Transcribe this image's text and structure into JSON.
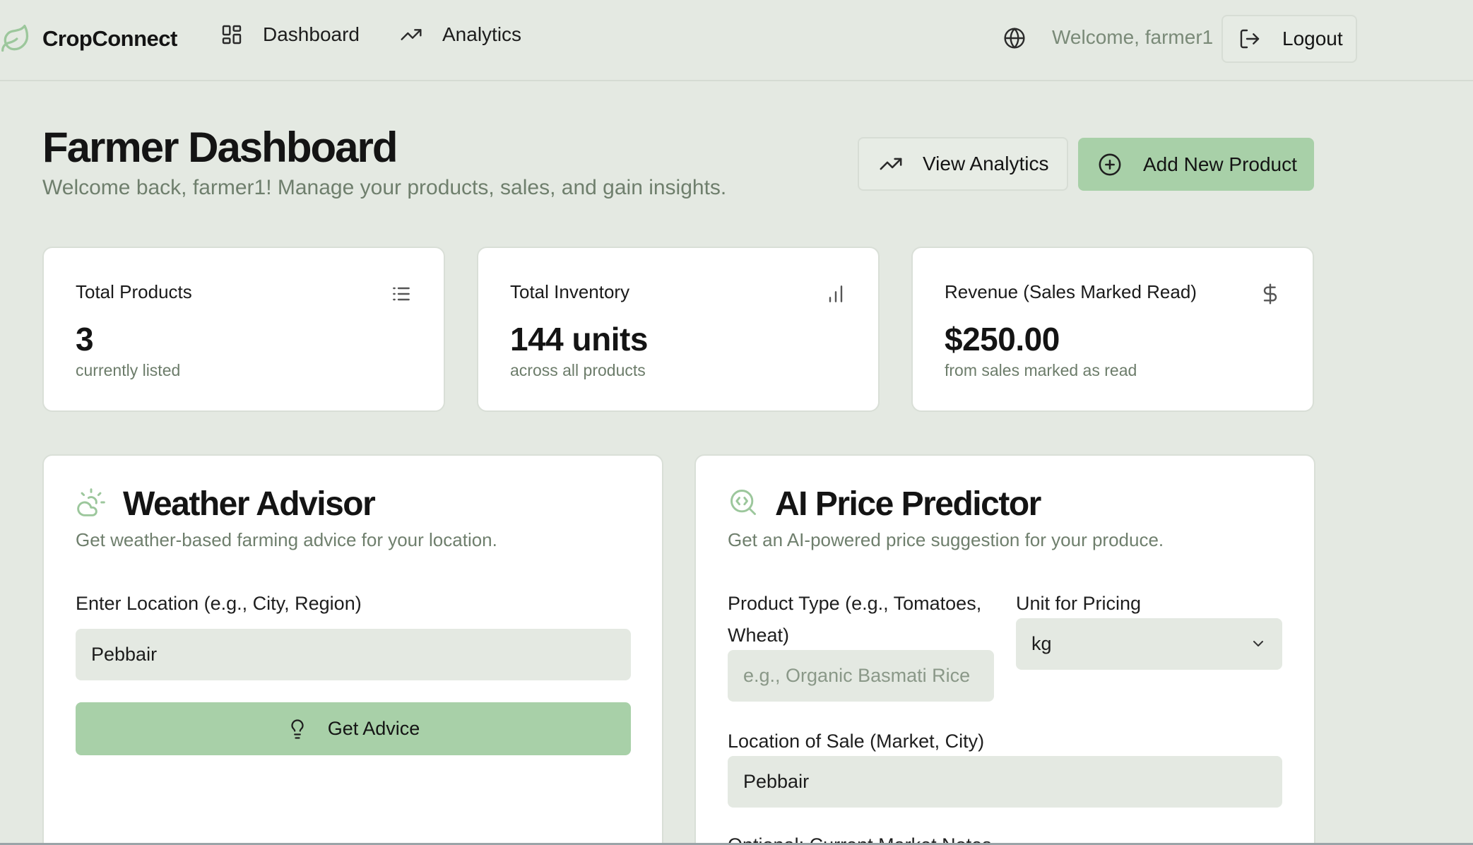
{
  "app": {
    "name": "CropConnect"
  },
  "nav": {
    "dashboard_label": "Dashboard",
    "analytics_label": "Analytics",
    "welcome_text": "Welcome, farmer1",
    "logout_label": "Logout"
  },
  "header": {
    "title": "Farmer Dashboard",
    "subtitle": "Welcome back, farmer1! Manage your products, sales, and gain insights.",
    "view_analytics_label": "View Analytics",
    "add_product_label": "Add New Product"
  },
  "stats": [
    {
      "label": "Total Products",
      "value": "3",
      "desc": "currently listed",
      "icon": "list-icon"
    },
    {
      "label": "Total Inventory",
      "value": "144 units",
      "desc": "across all products",
      "icon": "bar-chart-icon"
    },
    {
      "label": "Revenue (Sales Marked Read)",
      "value": "$250.00",
      "desc": "from sales marked as read",
      "icon": "dollar-icon"
    }
  ],
  "weather": {
    "title": "Weather Advisor",
    "subtitle": "Get weather-based farming advice for your location.",
    "location_label": "Enter Location (e.g., City, Region)",
    "location_value": "Pebbair",
    "button_label": "Get Advice"
  },
  "price": {
    "title": "AI Price Predictor",
    "subtitle": "Get an AI-powered price suggestion for your produce.",
    "product_label_line1": "Product Type (e.g., Tomatoes,",
    "product_label_line2": "Wheat)",
    "product_placeholder": "e.g., Organic Basmati Rice",
    "unit_label": "Unit for Pricing",
    "unit_value": "kg",
    "location_label": "Location of Sale (Market, City)",
    "location_value": "Pebbair",
    "notes_label": "Optional: Current Market Notes"
  },
  "colors": {
    "background": "#e4e9e2",
    "accent": "#a8d0a8",
    "accent_icon": "#9cc79c",
    "muted_text": "#6f7f6d"
  }
}
